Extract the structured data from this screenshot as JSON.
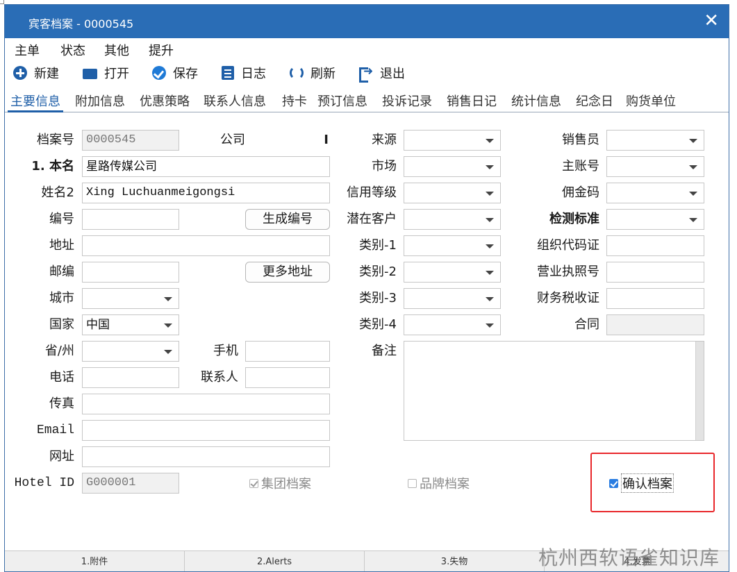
{
  "window": {
    "title": "宾客档案 - 0000545",
    "close_glyph": "✕"
  },
  "menu": [
    "主单",
    "状态",
    "其他",
    "提升"
  ],
  "toolbar": {
    "new": "新建",
    "open": "打开",
    "save": "保存",
    "log": "日志",
    "refresh": "刷新",
    "exit": "退出"
  },
  "tabs": [
    "主要信息",
    "附加信息",
    "优惠策略",
    "联系人信息",
    "持卡",
    "预订信息",
    "投诉记录",
    "销售日记",
    "统计信息",
    "纪念日",
    "购货单位"
  ],
  "active_tab": "主要信息",
  "form": {
    "archive_no_label": "档案号",
    "archive_no": "0000545",
    "company_label": "公司",
    "company_marker": "I",
    "name_label": "1. 本名",
    "name": "星路传媒公司",
    "name2_label": "姓名2",
    "name2": "Xing Luchuanmeigongsi",
    "code_label": "编号",
    "gen_code_button": "生成编号",
    "address_label": "地址",
    "postcode_label": "邮编",
    "more_address_button": "更多地址",
    "city_label": "城市",
    "country_label": "国家",
    "country": "中国",
    "province_label": "省/州",
    "mobile_label": "手机",
    "phone_label": "电话",
    "contact_label": "联系人",
    "fax_label": "传真",
    "email_label": "Email",
    "website_label": "网址",
    "hotel_id_label": "Hotel ID",
    "hotel_id": "G000001",
    "source_label": "来源",
    "market_label": "市场",
    "credit_label": "信用等级",
    "potential_label": "潜在客户",
    "cat1_label": "类别-1",
    "cat2_label": "类别-2",
    "cat3_label": "类别-3",
    "cat4_label": "类别-4",
    "remark_label": "备注",
    "sales_label": "销售员",
    "master_acct_label": "主账号",
    "commission_label": "佣金码",
    "standard_label": "检测标准",
    "org_code_label": "组织代码证",
    "license_label": "营业执照号",
    "tax_label": "财务税收证",
    "contract_label": "合同",
    "group_archive": "集团档案",
    "brand_archive": "品牌档案",
    "confirm_archive": "确认档案"
  },
  "bottom_tabs": [
    "1.附件",
    "2.Alerts",
    "3.失物",
    "4.发票"
  ],
  "watermark": "杭州西软语雀知识库",
  "colors": {
    "titlebar": "#2a6db6",
    "accent": "#1f5fa8",
    "highlight": "#e8262a"
  }
}
